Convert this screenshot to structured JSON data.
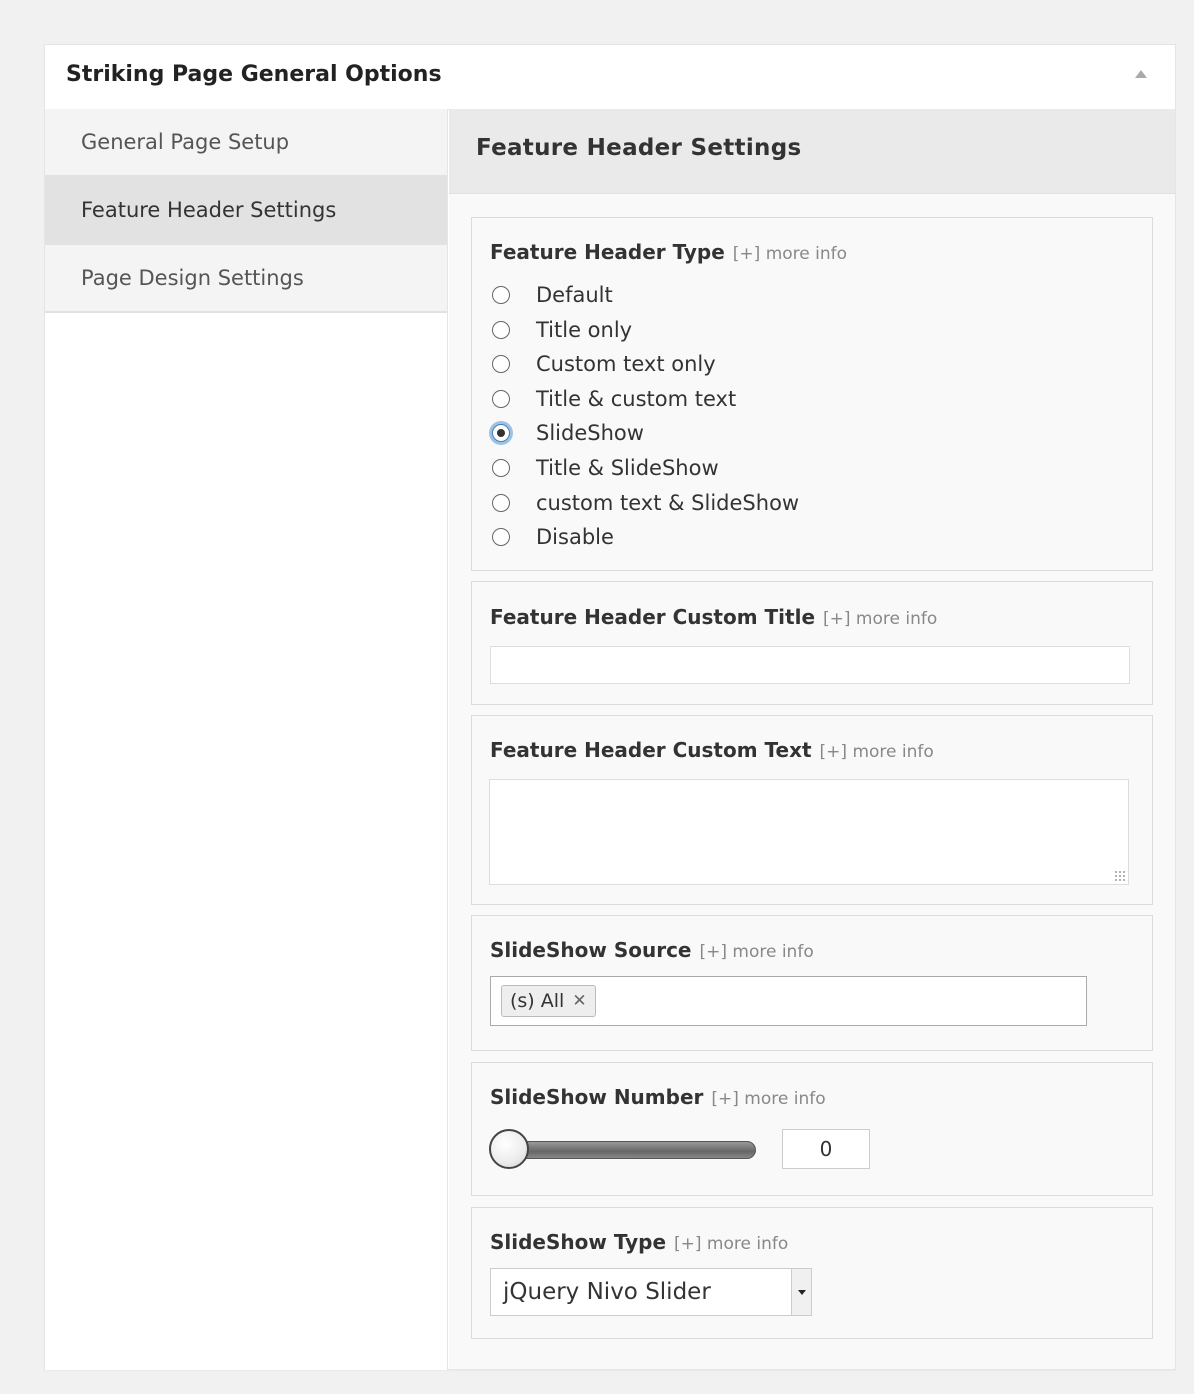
{
  "panel": {
    "title": "Striking Page General Options"
  },
  "sidebar": {
    "items": [
      {
        "label": "General Page Setup"
      },
      {
        "label": "Feature Header Settings"
      },
      {
        "label": "Page Design Settings"
      }
    ]
  },
  "content": {
    "title": "Feature Header Settings"
  },
  "more_info": "[+] more info",
  "header_type": {
    "label": "Feature Header Type",
    "options": [
      "Default",
      "Title only",
      "Custom text only",
      "Title & custom text",
      "SlideShow",
      "Title & SlideShow",
      "custom text & SlideShow",
      "Disable"
    ],
    "selected": "SlideShow"
  },
  "custom_title": {
    "label": "Feature Header Custom Title",
    "value": ""
  },
  "custom_text": {
    "label": "Feature Header Custom Text",
    "value": ""
  },
  "slideshow_source": {
    "label": "SlideShow Source",
    "tag": "(s) All",
    "remove_glyph": "✕"
  },
  "slideshow_number": {
    "label": "SlideShow Number",
    "value": "0"
  },
  "slideshow_type": {
    "label": "SlideShow Type",
    "selected": "jQuery Nivo Slider"
  },
  "colors": {
    "background": "#f1f1f1",
    "panel": "#ffffff",
    "active_nav": "#e2e2e2",
    "focus_ring": "#9cc3e6"
  }
}
